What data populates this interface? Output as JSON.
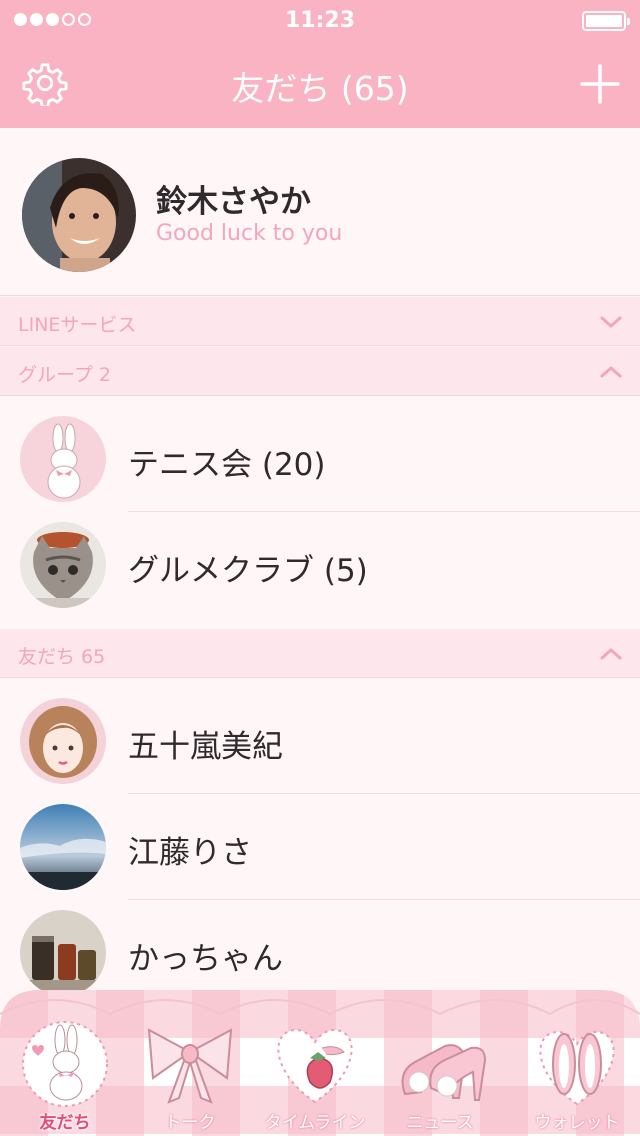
{
  "status_bar": {
    "time": "11:23",
    "signal_dots_filled": 3,
    "signal_dots_total": 5
  },
  "nav": {
    "title": "友だち (65)",
    "settings_icon": "gear-icon",
    "add_icon": "plus-icon"
  },
  "profile": {
    "name": "鈴木さやか",
    "status": "Good luck to you"
  },
  "sections": {
    "line_services": {
      "label": "LINEサービス",
      "state": "collapsed"
    },
    "groups": {
      "label": "グループ 2",
      "state": "expanded"
    },
    "friends": {
      "label": "友だち 65",
      "state": "expanded"
    }
  },
  "groups": [
    {
      "label": "テニス会 (20)",
      "avatar": "bunny-illustration"
    },
    {
      "label": "グルメクラブ (5)",
      "avatar": "cat-photo"
    }
  ],
  "friends": [
    {
      "label": "五十嵐美紀",
      "avatar": "girl-illustration"
    },
    {
      "label": "江藤りさ",
      "avatar": "sky-photo"
    },
    {
      "label": "かっちゃん",
      "avatar": "jars-photo"
    }
  ],
  "tabs": [
    {
      "label": "友だち",
      "icon": "bunny-icon",
      "active": true
    },
    {
      "label": "トーク",
      "icon": "ribbon-icon",
      "active": false
    },
    {
      "label": "タイムライン",
      "icon": "strawberry-icon",
      "active": false
    },
    {
      "label": "ニュース",
      "icon": "heels-icon",
      "active": false
    },
    {
      "label": "ウォレット",
      "icon": "bunny-ears-icon",
      "active": false
    }
  ],
  "colors": {
    "accent": "#f9b3c3",
    "section_bg": "#fde6ec",
    "active_tab": "#e04d7a",
    "subtext": "#f3a6bb"
  }
}
